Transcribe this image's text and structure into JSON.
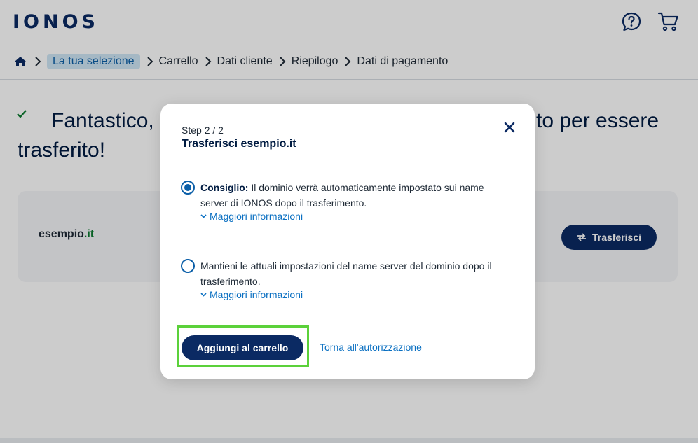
{
  "header": {
    "logo": "IONOS",
    "icons": {
      "help": "help-chat-icon",
      "cart": "cart-icon"
    }
  },
  "breadcrumb": {
    "home_icon": "home-icon",
    "items": [
      "La tua selezione",
      "Carrello",
      "Dati cliente",
      "Riepilogo",
      "Dati di pagamento"
    ]
  },
  "page": {
    "headline_left": "Fantastico,",
    "headline_right": "to per essere",
    "headline_line2": "trasferito!",
    "domain": {
      "name": "esempio",
      "tld": ".it"
    },
    "transfer_button": "Trasferisci"
  },
  "modal": {
    "step": "Step 2 / 2",
    "title": "Trasferisci esempio.it",
    "options": [
      {
        "bold": "Consiglio:",
        "text": " Il dominio verrà automaticamente impostato sui name server di IONOS dopo il trasferimento.",
        "more": "Maggiori informazioni",
        "selected": true
      },
      {
        "bold": "",
        "text": "Mantieni le attuali impostazioni del name server del dominio dopo il trasferimento.",
        "more": "Maggiori informazioni",
        "selected": false
      }
    ],
    "add_button": "Aggiungi al carrello",
    "back_link": "Torna all'autorizzazione"
  },
  "colors": {
    "brand_navy": "#0b2a63",
    "link_blue": "#0b70c2",
    "radio_blue": "#0b5fa8",
    "highlight_green": "#5bd13a",
    "crumb_active_bg": "#cfe6f6"
  }
}
